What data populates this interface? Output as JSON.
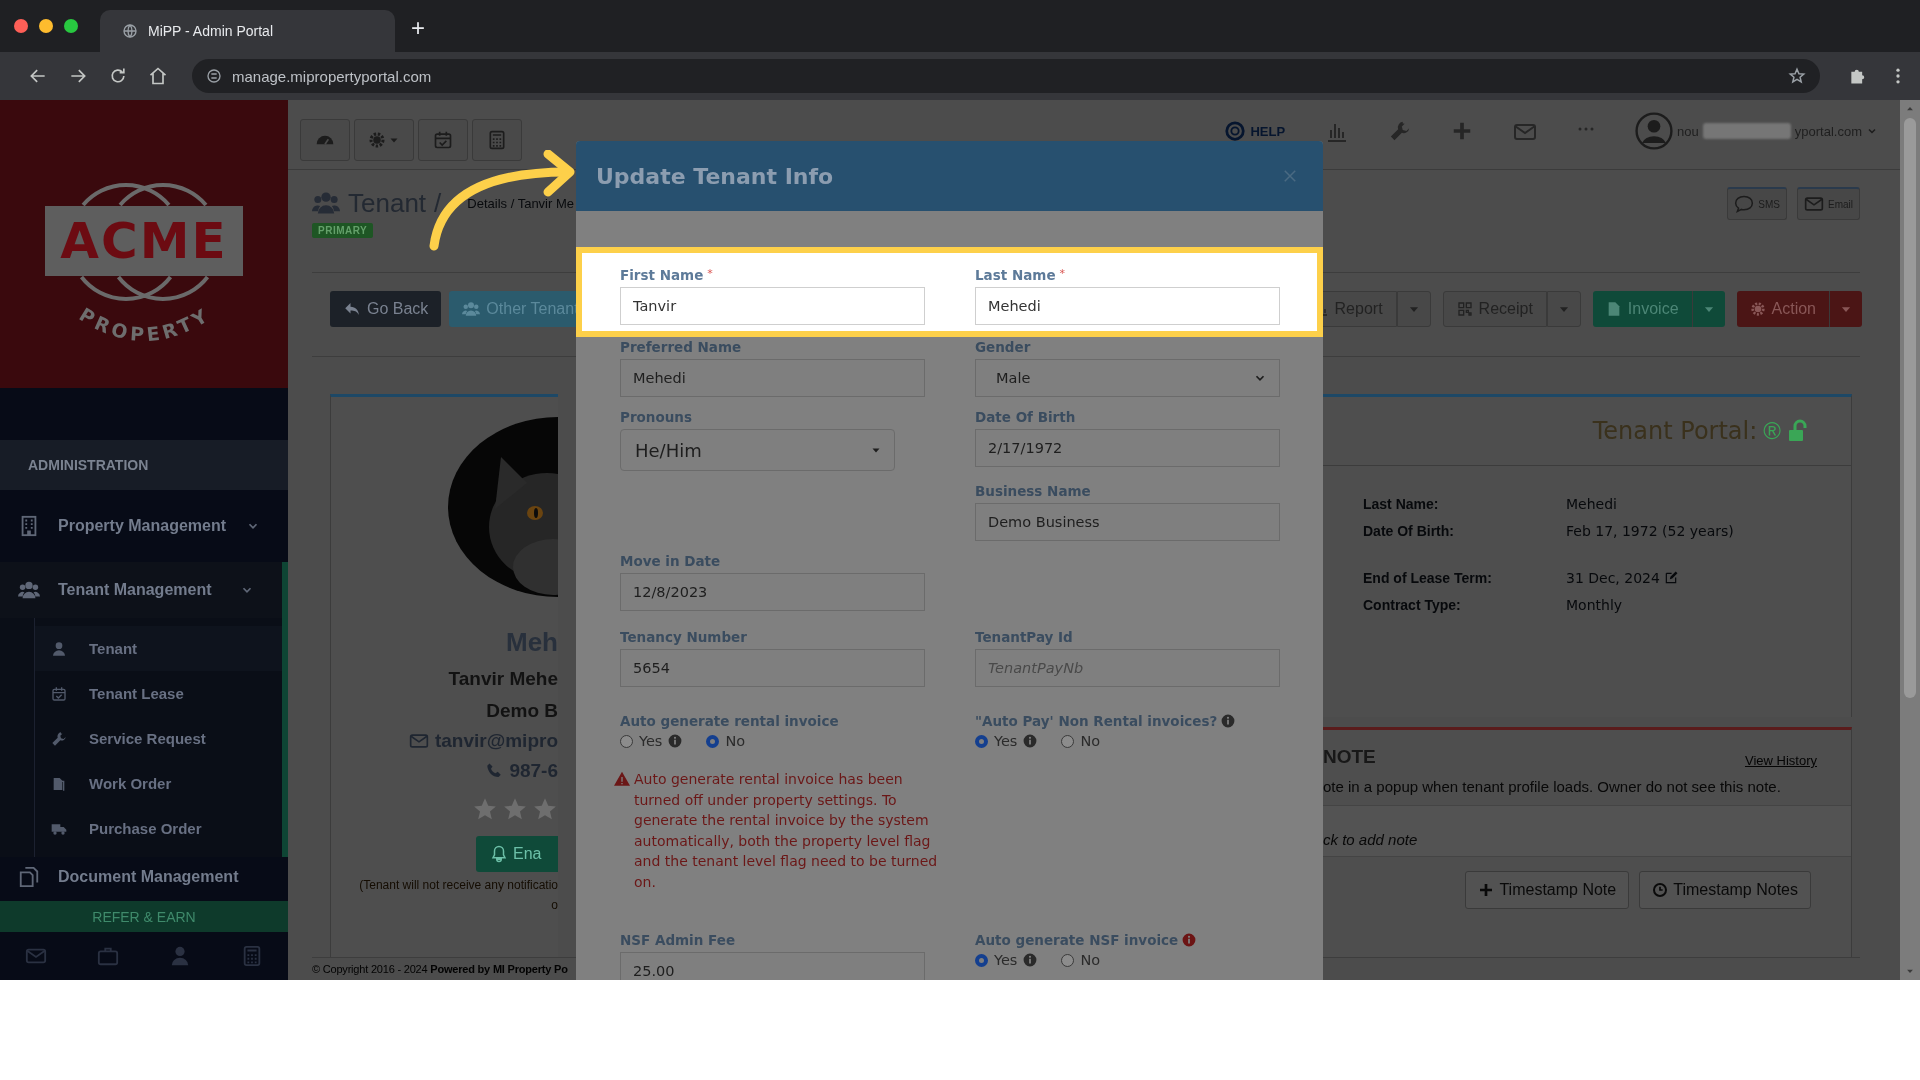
{
  "browser": {
    "tab_title": "MiPP - Admin Portal",
    "new_tab": "+",
    "url": "manage.mipropertyportal.com"
  },
  "sidebar": {
    "logo_word": "ACME",
    "logo_tagline": "PROPERTY",
    "section": "ADMINISTRATION",
    "items": [
      {
        "label": "Property Management",
        "kind": "group",
        "expanded": false
      },
      {
        "label": "Tenant Management",
        "kind": "group",
        "expanded": true,
        "children": [
          {
            "label": "Tenant",
            "selected": true
          },
          {
            "label": "Tenant Lease",
            "selected": false
          },
          {
            "label": "Service Request",
            "selected": false
          },
          {
            "label": "Work Order",
            "selected": false
          },
          {
            "label": "Purchase Order",
            "selected": false
          }
        ]
      },
      {
        "label": "Document Management",
        "kind": "link",
        "expanded": false
      }
    ],
    "refer": "REFER & EARN"
  },
  "topbar": {
    "help": "HELP",
    "user_start": "nou",
    "user_end": "yportal.com"
  },
  "page": {
    "title": "Tenant",
    "separator": "/",
    "breadcrumb": "Details / Tanvir Me",
    "badge": "PRIMARY",
    "contact_buttons": [
      "SMS",
      "Email"
    ],
    "left_buttons": [
      {
        "label": "Go Back",
        "kind": "dark"
      },
      {
        "label": "Other Tenant",
        "kind": "info"
      }
    ],
    "right_buttons": [
      {
        "label": "Report",
        "kind": "default"
      },
      {
        "label": "Receipt",
        "kind": "default"
      },
      {
        "label": "Invoice",
        "kind": "success"
      },
      {
        "label": "Action",
        "kind": "danger"
      }
    ]
  },
  "profile": {
    "name": "Meh",
    "full_name": "Tanvir Mehe",
    "business": "Demo B",
    "email": "tanvir@mipro",
    "phone": "987-6",
    "stars": 0,
    "notify_button": "Ena",
    "notice": [
      "(Tenant will not receive any notificatio",
      "o"
    ]
  },
  "portal": {
    "title": "Tenant Portal:",
    "mark": "®",
    "field_groups": [
      [
        {
          "label": "Last Name:",
          "value": "Mehedi",
          "editable": false
        },
        {
          "label": "Date Of Birth:",
          "value": "Feb 17, 1972 (52 years)",
          "editable": false
        }
      ],
      [
        {
          "label": "End of Lease Term:",
          "value": "31 Dec, 2024",
          "editable": true
        },
        {
          "label": "Contract Type:",
          "value": "Monthly",
          "editable": false
        }
      ]
    ]
  },
  "note": {
    "title": "NOTE",
    "history_link": "View History",
    "description": "ote in a popup when tenant profile loads. Owner do not see this note.",
    "add_hint": "ck to add note",
    "buttons": [
      "Timestamp Note",
      "Timestamp Notes"
    ]
  },
  "footer": "© Copyright 2016 - 2024 **Powered by MI Property Po**",
  "modal": {
    "title": "Update Tenant Info",
    "rows": [
      {
        "highlighted": true,
        "cells": [
          {
            "kind": "text",
            "label": "First Name",
            "required_mark": "*",
            "value": "Tanvir"
          },
          {
            "kind": "text",
            "label": "Last Name",
            "required_mark": "*",
            "value": "Mehedi"
          }
        ]
      },
      {
        "highlighted": false,
        "cells": [
          {
            "kind": "text",
            "label": "Preferred Name",
            "value": "Mehedi"
          },
          {
            "kind": "select",
            "label": "Gender",
            "value": "Male"
          }
        ]
      },
      {
        "highlighted": false,
        "cells": [
          {
            "kind": "dropdown",
            "label": "Pronouns",
            "value": "He/Him"
          },
          {
            "kind": "text",
            "label": "Date Of Birth",
            "value": "2/17/1972"
          }
        ]
      },
      {
        "highlighted": false,
        "cells": [
          null,
          {
            "kind": "text",
            "label": "Business Name",
            "value": "Demo Business"
          }
        ]
      },
      {
        "highlighted": false,
        "cells": [
          {
            "kind": "text",
            "label": "Move in Date",
            "value": "12/8/2023"
          },
          null
        ]
      },
      {
        "highlighted": false,
        "cells": [
          {
            "kind": "text",
            "label": "Tenancy Number",
            "value": "5654"
          },
          {
            "kind": "text",
            "label": "TenantPay Id",
            "placeholder": "TenantPayNb"
          }
        ]
      },
      {
        "highlighted": false,
        "cells": [
          {
            "kind": "radio",
            "label": "Auto generate rental invoice",
            "options": [
              {
                "label": "Yes",
                "info": true,
                "selected": false
              },
              {
                "label": "No",
                "info": false,
                "selected": true
              }
            ]
          },
          {
            "kind": "radio",
            "label": "\"Auto Pay' Non Rental invoices?",
            "label_info": true,
            "label_info_alert": false,
            "options": [
              {
                "label": "Yes",
                "info": true,
                "selected": true
              },
              {
                "label": "No",
                "info": false,
                "selected": false
              }
            ]
          }
        ]
      },
      {
        "highlighted": false,
        "cells": [
          {
            "kind": "warning",
            "text": "Auto generate rental invoice has been turned off under property settings. To generate the rental invoice by the system automatically, both the property level flag and the tenant level flag need to be turned on."
          },
          null
        ]
      },
      {
        "highlighted": false,
        "cells": [
          {
            "kind": "text",
            "label": "NSF Admin Fee",
            "value": "25.00"
          },
          {
            "kind": "radio",
            "label": "Auto generate NSF invoice",
            "label_info": true,
            "label_info_alert": true,
            "options": [
              {
                "label": "Yes",
                "info": true,
                "selected": true
              },
              {
                "label": "No",
                "info": false,
                "selected": false
              }
            ]
          }
        ]
      }
    ]
  }
}
